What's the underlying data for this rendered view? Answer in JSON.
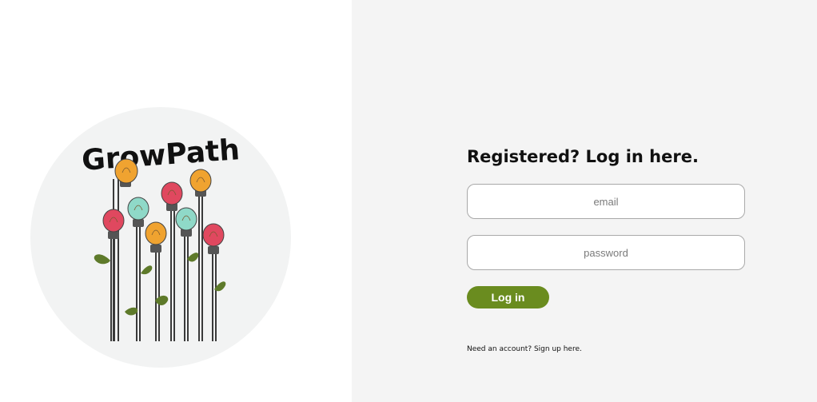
{
  "logo": {
    "text": "GrowPath",
    "icon": "lightbulb-flowers-illustration",
    "colors": {
      "circle": "#f2f3f3",
      "red_bulb": "#e0485f",
      "orange_bulb": "#f0a330",
      "mint_bulb": "#8fd9c8",
      "leaf": "#5e7a2a",
      "stem": "#3a3a3a"
    }
  },
  "login": {
    "heading": "Registered? Log in here.",
    "email_placeholder": "email",
    "password_placeholder": "password",
    "submit_label": "Log in",
    "signup_text": "Need an account? Sign up here."
  },
  "theme": {
    "left_background": "#ffffff",
    "right_background": "#f4f4f4",
    "button_color": "#6a8c1f"
  }
}
